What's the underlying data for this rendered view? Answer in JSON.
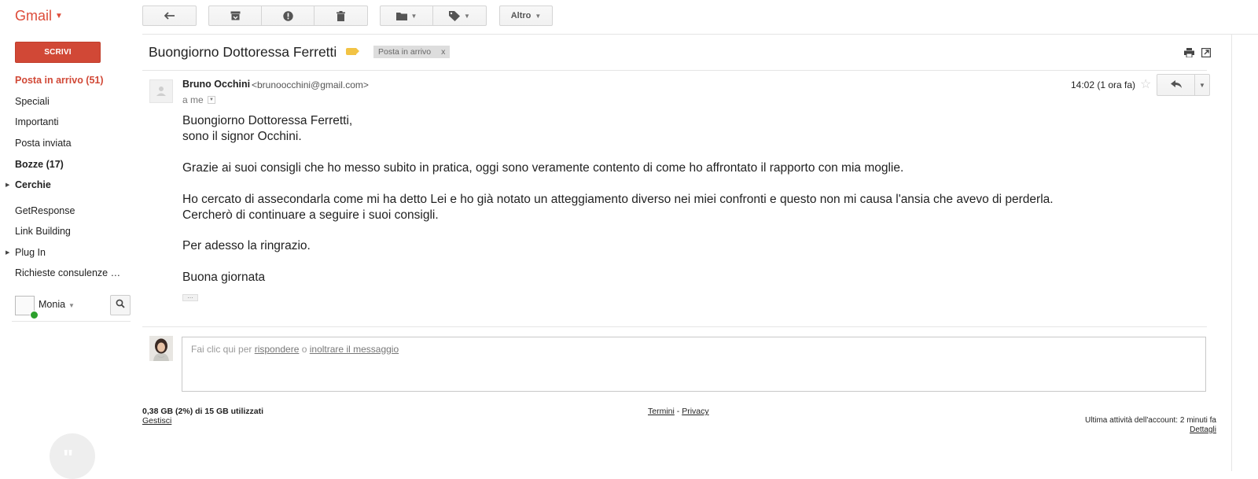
{
  "brand": {
    "logo_text": "Gmail"
  },
  "toolbar": {
    "more_label": "Altro"
  },
  "sidebar": {
    "compose_label": "SCRIVI",
    "items": [
      {
        "label": "Posta in arrivo (51)"
      },
      {
        "label": "Speciali"
      },
      {
        "label": "Importanti"
      },
      {
        "label": "Posta inviata"
      },
      {
        "label": "Bozze (17)"
      },
      {
        "label": "Cerchie"
      },
      {
        "label": "GetResponse"
      },
      {
        "label": "Link Building"
      },
      {
        "label": "Plug In"
      },
      {
        "label": "Richieste consulenze …"
      }
    ],
    "chat_user": "Monia"
  },
  "thread": {
    "subject": "Buongiorno Dottoressa Ferretti",
    "label_chip": "Posta in arrivo",
    "label_chip_close": "x"
  },
  "message": {
    "sender_name": "Bruno Occhini",
    "sender_email": "<brunoocchini@gmail.com>",
    "to": "a me",
    "time": "14:02 (1 ora fa)",
    "body": [
      "Buongiorno Dottoressa Ferretti,",
      "sono il signor Occhini.",
      "Grazie ai suoi consigli che ho messo subito in pratica, oggi sono veramente contento di come ho affrontato il rapporto con mia moglie.",
      "Ho cercato di assecondarla come mi ha detto Lei e ho già notato un atteggiamento diverso nei miei confronti e questo non mi causa l'ansia che avevo di perderla.",
      "Cercherò di continuare a seguire i suoi consigli.",
      "Per adesso la ringrazio.",
      "Buona giornata"
    ],
    "ellipsis": "…"
  },
  "reply": {
    "prefix": "Fai clic qui per ",
    "reply_link": "rispondere",
    "middle": " o ",
    "forward_link": "inoltrare il messaggio"
  },
  "footer": {
    "storage": "0,38 GB (2%) di 15 GB utilizzati",
    "manage": "Gestisci",
    "terms": "Termini",
    "separator": " - ",
    "privacy": "Privacy",
    "last_activity": "Ultima attività dell'account: 2 minuti fa",
    "details": "Dettagli"
  },
  "colors": {
    "accent_red": "#d14836",
    "label_yellow": "#f2c344",
    "online_green": "#2ca02c"
  },
  "icons": [
    "back-arrow-icon",
    "archive-icon",
    "report-spam-icon",
    "delete-icon",
    "folder-icon",
    "tag-icon",
    "print-icon",
    "new-window-icon",
    "star-icon",
    "reply-icon",
    "search-icon",
    "hangouts-quote-icon"
  ]
}
